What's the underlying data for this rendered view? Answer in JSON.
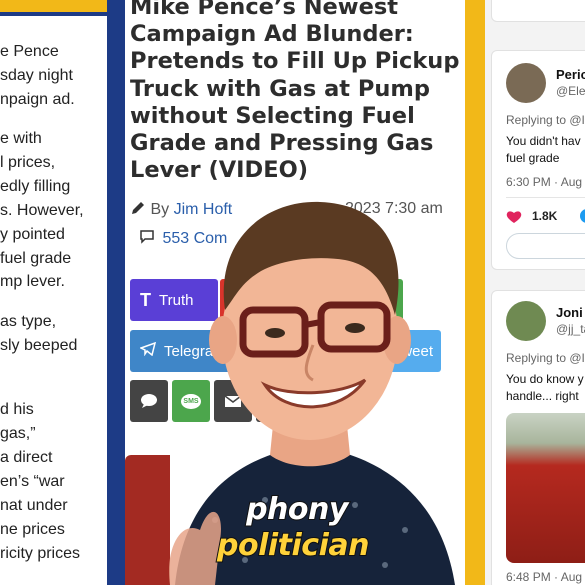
{
  "left_article": {
    "lines": [
      "e Pence",
      "sday night",
      "npaign ad.",
      "e with",
      "l prices,",
      "edly filling",
      "s. However,",
      "y pointed",
      "fuel grade",
      "mp lever.",
      "as type,",
      "sly beeped",
      "d his",
      "gas,”",
      "a direct",
      "en’s “war",
      "nat under",
      "ne prices",
      "ricity prices"
    ]
  },
  "article": {
    "title": "Mike Pence’s Newest Campaign Ad Blunder: Pretends to Fill Up Pickup Truck with Gas at Pump without Selecting Fuel Grade and Pressing Gas Lever (VIDEO)",
    "by_label": "By",
    "author": "Jim Hoft",
    "date": "2023 7:30 am",
    "comments": "553 Com"
  },
  "share": {
    "truth_label": "Truth",
    "telegram_label": "Telegram",
    "tweet_label": "Tweet",
    "sms_label": "SMS",
    "colors": {
      "truth": "#5a3fd6",
      "telegram": "#3f86c8",
      "tweet": "#55acee",
      "green": "#4ca64c",
      "dark": "#444444"
    }
  },
  "caption": {
    "line1": "phony",
    "line2": "politician"
  },
  "tweets": [
    {
      "name": "Pericl",
      "handle": "@Elec",
      "replying": "Replying to @I",
      "text_lines": [
        "You didn't hav",
        "fuel grade"
      ],
      "time": "6:30 PM · Aug",
      "likes": "1.8K"
    },
    {
      "name": "Joni J",
      "handle": "@jj_ta",
      "replying": "Replying to @I",
      "text_lines": [
        "You do know y",
        "handle... right"
      ],
      "time": "6:48 PM · Aug"
    }
  ]
}
